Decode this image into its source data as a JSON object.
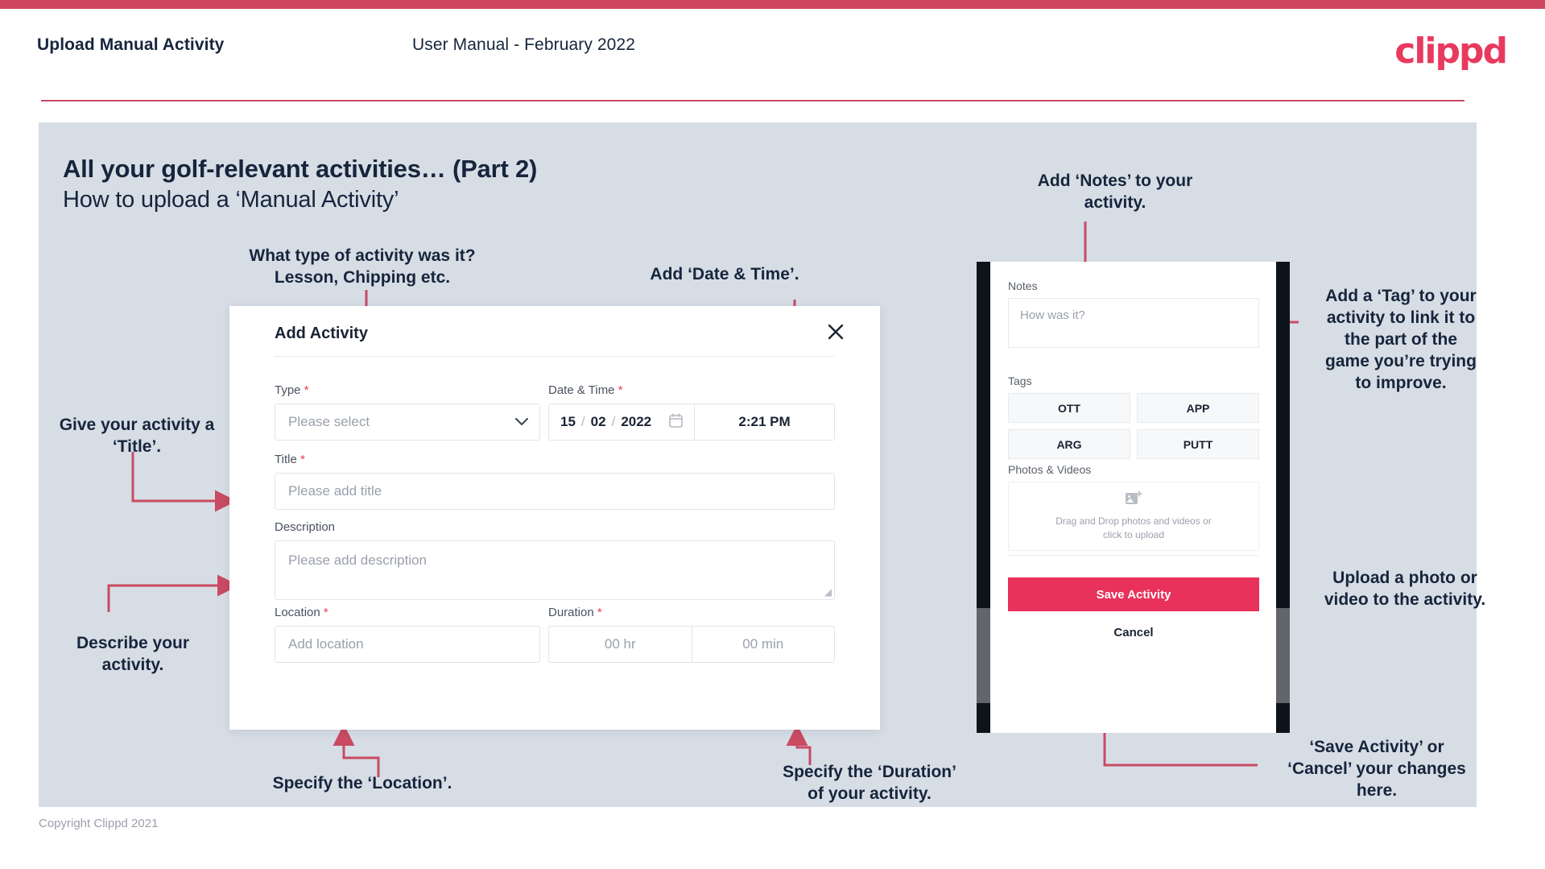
{
  "header": {
    "title": "Upload Manual Activity",
    "subtitle": "User Manual - February 2022",
    "logo": "clippd"
  },
  "slide": {
    "title": "All your golf-relevant activities… (Part 2)",
    "subtitle": "How to upload a ‘Manual Activity’"
  },
  "annotations": {
    "type": "What type of activity was it?\nLesson, Chipping etc.",
    "date_time": "Add ‘Date & Time’.",
    "title": "Give your activity a\n‘Title’.",
    "description": "Describe your\nactivity.",
    "location": "Specify the ‘Location’.",
    "duration": "Specify the ‘Duration’\nof your activity.",
    "notes": "Add ‘Notes’ to your\nactivity.",
    "tags": "Add a ‘Tag’ to your\nactivity to link it to\nthe part of the\ngame you’re trying\nto improve.",
    "upload": "Upload a photo or\nvideo to the activity.",
    "save_cancel": "‘Save Activity’ or\n‘Cancel’ your changes\nhere."
  },
  "dialog": {
    "title": "Add Activity",
    "close_icon": "close-icon",
    "fields": {
      "type": {
        "label": "Type",
        "required": "*",
        "placeholder": "Please select",
        "chevron_icon": "chevron-down-icon"
      },
      "datetime": {
        "label": "Date & Time",
        "required": "*",
        "day": "15",
        "month": "02",
        "year": "2022",
        "sep": "/",
        "calendar_icon": "calendar-icon",
        "time": "2:21 PM"
      },
      "title": {
        "label": "Title",
        "required": "*",
        "placeholder": "Please add title"
      },
      "description": {
        "label": "Description",
        "required": "",
        "placeholder": "Please add description"
      },
      "location": {
        "label": "Location",
        "required": "*",
        "placeholder": "Add location"
      },
      "duration": {
        "label": "Duration",
        "required": "*",
        "hours_placeholder": "00 hr",
        "minutes_placeholder": "00 min"
      }
    }
  },
  "phone": {
    "notes": {
      "label": "Notes",
      "placeholder": "How was it?"
    },
    "tags": {
      "label": "Tags",
      "items": [
        "OTT",
        "APP",
        "ARG",
        "PUTT"
      ]
    },
    "photos": {
      "label": "Photos & Videos",
      "icon": "add-image-icon",
      "drop_line1": "Drag and Drop photos and videos or",
      "drop_line2": "click to upload"
    },
    "save_label": "Save Activity",
    "cancel_label": "Cancel"
  },
  "footer": {
    "copyright": "Copyright Clippd 2021"
  },
  "colors": {
    "brand": "#e8315b",
    "topbar": "#cf4661",
    "panel": "#d7dde5",
    "ink": "#16253c",
    "connector": "#c94a63"
  }
}
